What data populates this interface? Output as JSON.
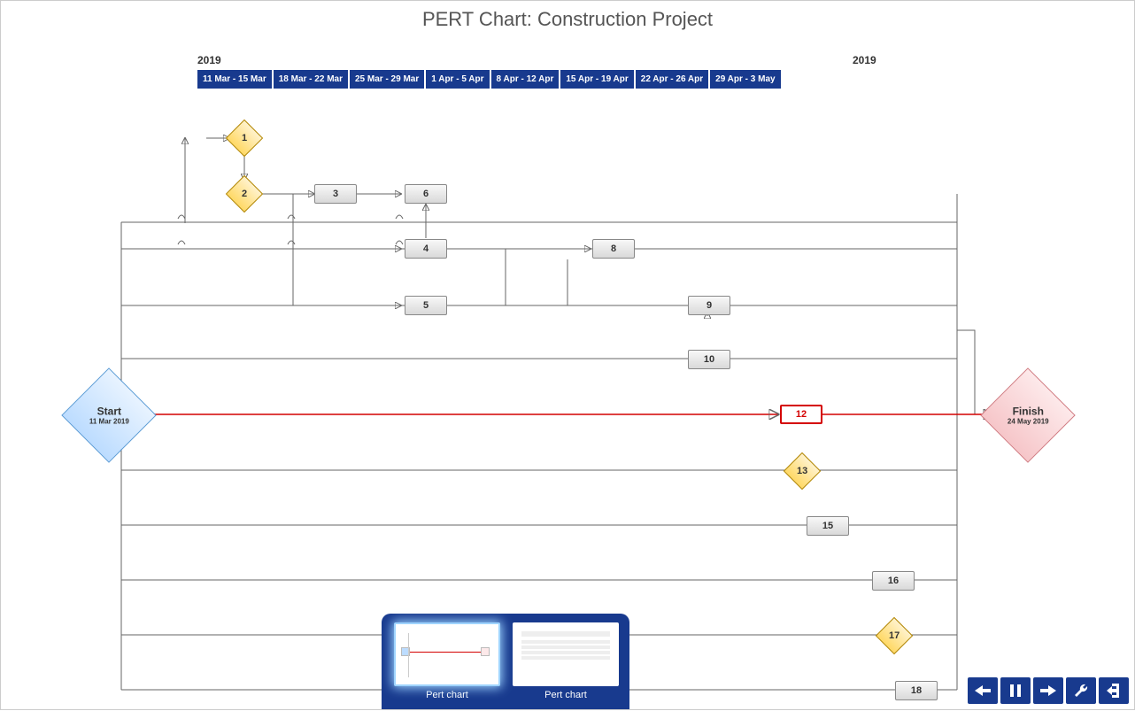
{
  "title": "PERT Chart: Construction Project",
  "timeline": {
    "year_left_label": "2019",
    "year_right_label": "2019",
    "weeks": [
      "11 Mar - 15 Mar",
      "18 Mar - 22 Mar",
      "25 Mar - 29 Mar",
      "1 Apr - 5 Apr",
      "8 Apr - 12 Apr",
      "15 Apr - 19 Apr",
      "22 Apr - 26 Apr",
      "29 Apr - 3 May"
    ]
  },
  "start": {
    "label": "Start",
    "date": "11 Mar 2019"
  },
  "finish": {
    "label": "Finish",
    "date": "24 May 2019"
  },
  "nodes": {
    "n1": "1",
    "n2": "2",
    "n3": "3",
    "n4": "4",
    "n5": "5",
    "n6": "6",
    "n8": "8",
    "n9": "9",
    "n10": "10",
    "n12": "12",
    "n13": "13",
    "n15": "15",
    "n16": "16",
    "n17": "17",
    "n18": "18"
  },
  "thumbnails": {
    "left": "Pert chart",
    "right": "Pert chart"
  },
  "toolbar": {
    "back": "back-icon",
    "pause": "pause-icon",
    "forward": "forward-icon",
    "settings": "wrench-icon",
    "exit": "exit-icon"
  }
}
